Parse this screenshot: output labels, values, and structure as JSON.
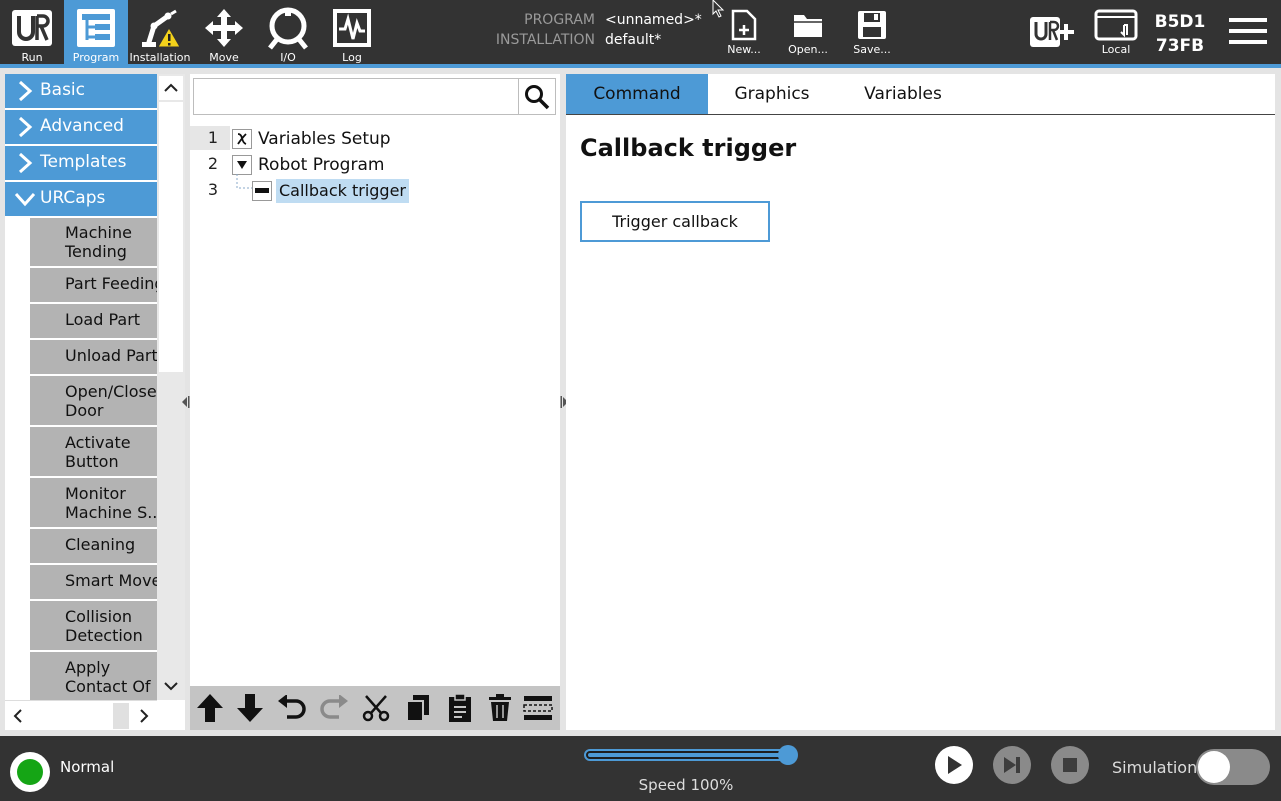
{
  "topnav": {
    "items": [
      {
        "label": "Run",
        "icon": "ur-logo-icon"
      },
      {
        "label": "Program",
        "icon": "program-tree-icon"
      },
      {
        "label": "Installation",
        "icon": "robot-arm-warning-icon"
      },
      {
        "label": "Move",
        "icon": "move-arrows-icon"
      },
      {
        "label": "I/O",
        "icon": "io-icon"
      },
      {
        "label": "Log",
        "icon": "log-chart-icon"
      }
    ],
    "active": "Program"
  },
  "program_info": {
    "program_key": "PROGRAM",
    "program_value": "<unnamed>*",
    "installation_key": "INSTALLATION",
    "installation_value": "default*"
  },
  "file_actions": {
    "new_label": "New...",
    "open_label": "Open...",
    "save_label": "Save..."
  },
  "top_right": {
    "local_label": "Local",
    "robot_id_line1": "B5D1",
    "robot_id_line2": "73FB"
  },
  "sidebar": {
    "categories": [
      {
        "label": "Basic",
        "expanded": false
      },
      {
        "label": "Advanced",
        "expanded": false
      },
      {
        "label": "Templates",
        "expanded": false
      },
      {
        "label": "URCaps",
        "expanded": true
      }
    ],
    "urcaps_items": [
      {
        "line1": "Machine",
        "line2": "Tending"
      },
      {
        "line1": "Part Feeding",
        "line2": ""
      },
      {
        "line1": "Load Part",
        "line2": ""
      },
      {
        "line1": "Unload Part",
        "line2": ""
      },
      {
        "line1": "Open/Close",
        "line2": "Door"
      },
      {
        "line1": "Activate",
        "line2": "Button"
      },
      {
        "line1": "Monitor",
        "line2": "Machine S..."
      },
      {
        "line1": "Cleaning",
        "line2": ""
      },
      {
        "line1": "Smart Move",
        "line2": ""
      },
      {
        "line1": "Collision",
        "line2": "Detection"
      },
      {
        "line1": "Apply",
        "line2": "Contact Of"
      }
    ]
  },
  "tree": {
    "search_value": "",
    "rows": [
      {
        "num": "1",
        "label": "Variables Setup"
      },
      {
        "num": "2",
        "label": "Robot Program"
      },
      {
        "num": "3",
        "label": "Callback trigger"
      }
    ]
  },
  "tabs": [
    "Command",
    "Graphics",
    "Variables"
  ],
  "active_tab": "Command",
  "command": {
    "title": "Callback trigger",
    "button_label": "Trigger callback"
  },
  "footer": {
    "status": "Normal",
    "speed_label": "Speed 100%",
    "speed_value": 1.0,
    "simulation_label": "Simulation",
    "simulation_on": false
  },
  "colors": {
    "accent": "#4d9ad6",
    "bar": "#333333",
    "status_ok": "#15a515"
  }
}
